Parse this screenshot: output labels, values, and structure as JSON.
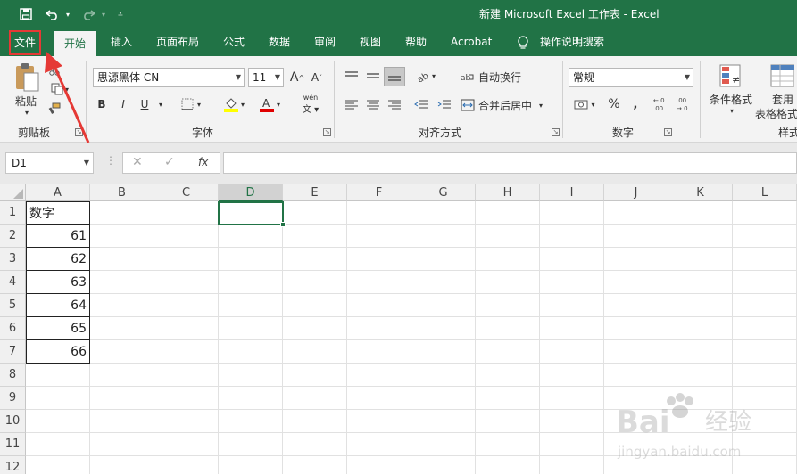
{
  "window": {
    "title": "新建 Microsoft Excel 工作表  -  Excel"
  },
  "quick_access": {
    "icons": [
      "save-icon",
      "undo-icon",
      "redo-icon",
      "customize-icon"
    ]
  },
  "tabs": [
    {
      "label": "文件",
      "highlighted": true
    },
    {
      "label": "开始",
      "active": true
    },
    {
      "label": "插入"
    },
    {
      "label": "页面布局"
    },
    {
      "label": "公式"
    },
    {
      "label": "数据"
    },
    {
      "label": "审阅"
    },
    {
      "label": "视图"
    },
    {
      "label": "帮助"
    },
    {
      "label": "Acrobat"
    },
    {
      "label": "操作说明搜索"
    }
  ],
  "ribbon": {
    "clipboard": {
      "label": "剪贴板",
      "paste_label": "粘贴"
    },
    "font": {
      "label": "字体",
      "font_name": "思源黑体 CN",
      "font_size": "11",
      "bold": "B",
      "italic": "I",
      "underline": "U",
      "grow": "A",
      "shrink": "A",
      "phonetic": "wén"
    },
    "alignment": {
      "label": "对齐方式",
      "wrap_text": "自动换行",
      "merge_center": "合并后居中"
    },
    "number": {
      "label": "数字",
      "format": "常规",
      "percent": "%",
      "inc_decimal": "←.0\n.00",
      "dec_decimal": ".00\n→.0"
    },
    "styles": {
      "label": "样式",
      "conditional_format": "条件格式",
      "format_as_table_1": "套用",
      "format_as_table_2": "表格格式"
    }
  },
  "formula_bar": {
    "name_box": "D1",
    "fx": "fx",
    "formula": ""
  },
  "sheet": {
    "columns": [
      "A",
      "B",
      "C",
      "D",
      "E",
      "F",
      "G",
      "H",
      "I",
      "J",
      "K",
      "L"
    ],
    "selected_column": "D",
    "rows": [
      "1",
      "2",
      "3",
      "4",
      "5",
      "6",
      "7",
      "8",
      "9",
      "10",
      "11",
      "12"
    ],
    "cells": {
      "A1": "数字",
      "A2": "61",
      "A3": "62",
      "A4": "63",
      "A5": "64",
      "A6": "65",
      "A7": "66"
    },
    "active_cell": "D1"
  },
  "watermark": {
    "text": "Baidu经验",
    "url": "jingyan.baidu.com"
  },
  "colors": {
    "excel_green": "#217346",
    "highlight_red": "#e53935"
  }
}
